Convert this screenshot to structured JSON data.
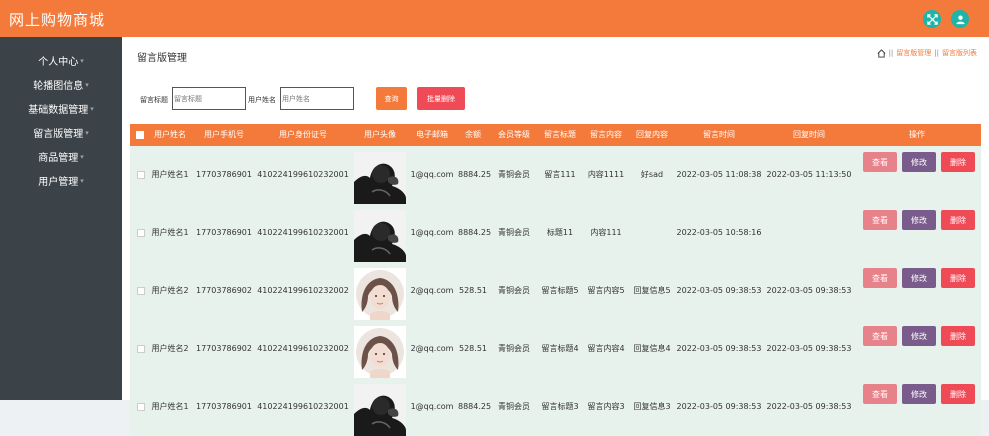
{
  "app": {
    "title": "网上购物商城"
  },
  "header_icons": [
    "expand-icon",
    "user-icon"
  ],
  "sidebar": {
    "items": [
      {
        "label": "个人中心"
      },
      {
        "label": "轮播图信息"
      },
      {
        "label": "基础数据管理"
      },
      {
        "label": "留言版管理"
      },
      {
        "label": "商品管理"
      },
      {
        "label": "用户管理"
      }
    ]
  },
  "page": {
    "title": "留言版管理",
    "breadcrumb": [
      "留言版管理",
      "留言版列表"
    ],
    "breadcrumb_sep": "||"
  },
  "search": {
    "title_label": "留言标题",
    "title_placeholder": "留言标题",
    "user_label": "用户姓名",
    "user_placeholder": "用户姓名",
    "query_button": "查询",
    "batch_delete_button": "批量删除"
  },
  "table": {
    "columns": [
      "用户姓名",
      "用户手机号",
      "用户身份证号",
      "用户头像",
      "电子邮箱",
      "余额",
      "会员等级",
      "留言标题",
      "留言内容",
      "回复内容",
      "留言时间",
      "回复时间",
      "操作"
    ],
    "action_labels": {
      "view": "查看",
      "edit": "修改",
      "delete": "删除"
    },
    "rows": [
      {
        "name": "用户姓名1",
        "phone": "17703786901",
        "idcard": "410224199610232001",
        "avatar": "man-avatar",
        "email": "1@qq.com",
        "balance": "8884.25",
        "level": "青铜会员",
        "title": "留言111",
        "content": "内容1111",
        "reply": "好sad",
        "time": "2022-03-05 11:08:38",
        "reply_time": "2022-03-05 11:13:50"
      },
      {
        "name": "用户姓名1",
        "phone": "17703786901",
        "idcard": "410224199610232001",
        "avatar": "man-avatar",
        "email": "1@qq.com",
        "balance": "8884.25",
        "level": "青铜会员",
        "title": "标题11",
        "content": "内容111",
        "reply": "",
        "time": "2022-03-05 10:58:16",
        "reply_time": ""
      },
      {
        "name": "用户姓名2",
        "phone": "17703786902",
        "idcard": "410224199610232002",
        "avatar": "woman-avatar",
        "email": "2@qq.com",
        "balance": "528.51",
        "level": "青铜会员",
        "title": "留言标题5",
        "content": "留言内容5",
        "reply": "回复信息5",
        "time": "2022-03-05 09:38:53",
        "reply_time": "2022-03-05 09:38:53"
      },
      {
        "name": "用户姓名2",
        "phone": "17703786902",
        "idcard": "410224199610232002",
        "avatar": "woman-avatar",
        "email": "2@qq.com",
        "balance": "528.51",
        "level": "青铜会员",
        "title": "留言标题4",
        "content": "留言内容4",
        "reply": "回复信息4",
        "time": "2022-03-05 09:38:53",
        "reply_time": "2022-03-05 09:38:53"
      },
      {
        "name": "用户姓名1",
        "phone": "17703786901",
        "idcard": "410224199610232001",
        "avatar": "man-avatar",
        "email": "1@qq.com",
        "balance": "8884.25",
        "level": "青铜会员",
        "title": "留言标题3",
        "content": "留言内容3",
        "reply": "回复信息3",
        "time": "2022-03-05 09:38:53",
        "reply_time": "2022-03-05 09:38:53"
      }
    ]
  },
  "colors": {
    "brand": "#f47a3c",
    "sidebar": "#3c4348",
    "row_bg": "#e8f2ec",
    "view_btn": "#e8828a",
    "edit_btn": "#7a5c8c",
    "delete_btn": "#ef4b57",
    "query_btn": "#f47a3c",
    "batch_btn": "#ef4b57",
    "header_icon": "#1cb5a8"
  }
}
